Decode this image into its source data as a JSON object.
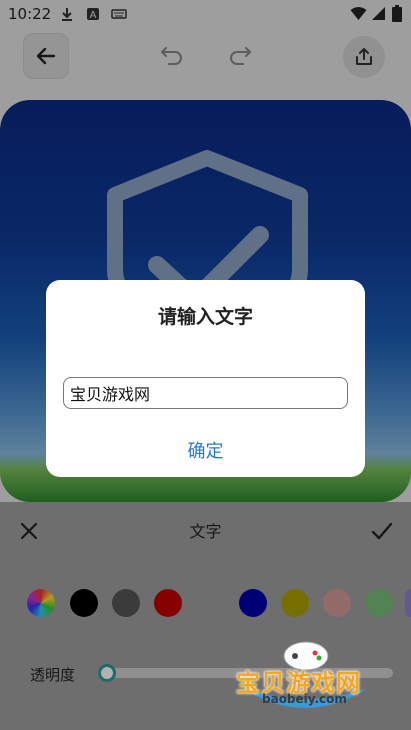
{
  "status_bar": {
    "time": "10:22",
    "icons": [
      "download-icon",
      "keyboard-a-icon",
      "keyboard-icon",
      "wifi-icon",
      "signal-icon",
      "battery-icon"
    ]
  },
  "toolbar": {
    "back_icon": "arrow-left-icon",
    "undo_icon": "undo-icon",
    "redo_icon": "redo-icon",
    "share_icon": "share-icon"
  },
  "dialog": {
    "title": "请输入文字",
    "input_value": "宝贝游戏网",
    "confirm_label": "确定"
  },
  "panel": {
    "title": "文字",
    "close_icon": "close-icon",
    "confirm_icon": "check-icon",
    "colors": [
      "rainbow",
      "#000000",
      "#555555",
      "#c00000",
      "#0000aa",
      "#aaa000",
      "#d49a9a",
      "#77bb77",
      "#8a7fd8"
    ],
    "opacity_label": "透明度",
    "opacity_value": 0
  },
  "watermark": {
    "text": "宝贝游戏网",
    "url": "baobeiy.com"
  }
}
